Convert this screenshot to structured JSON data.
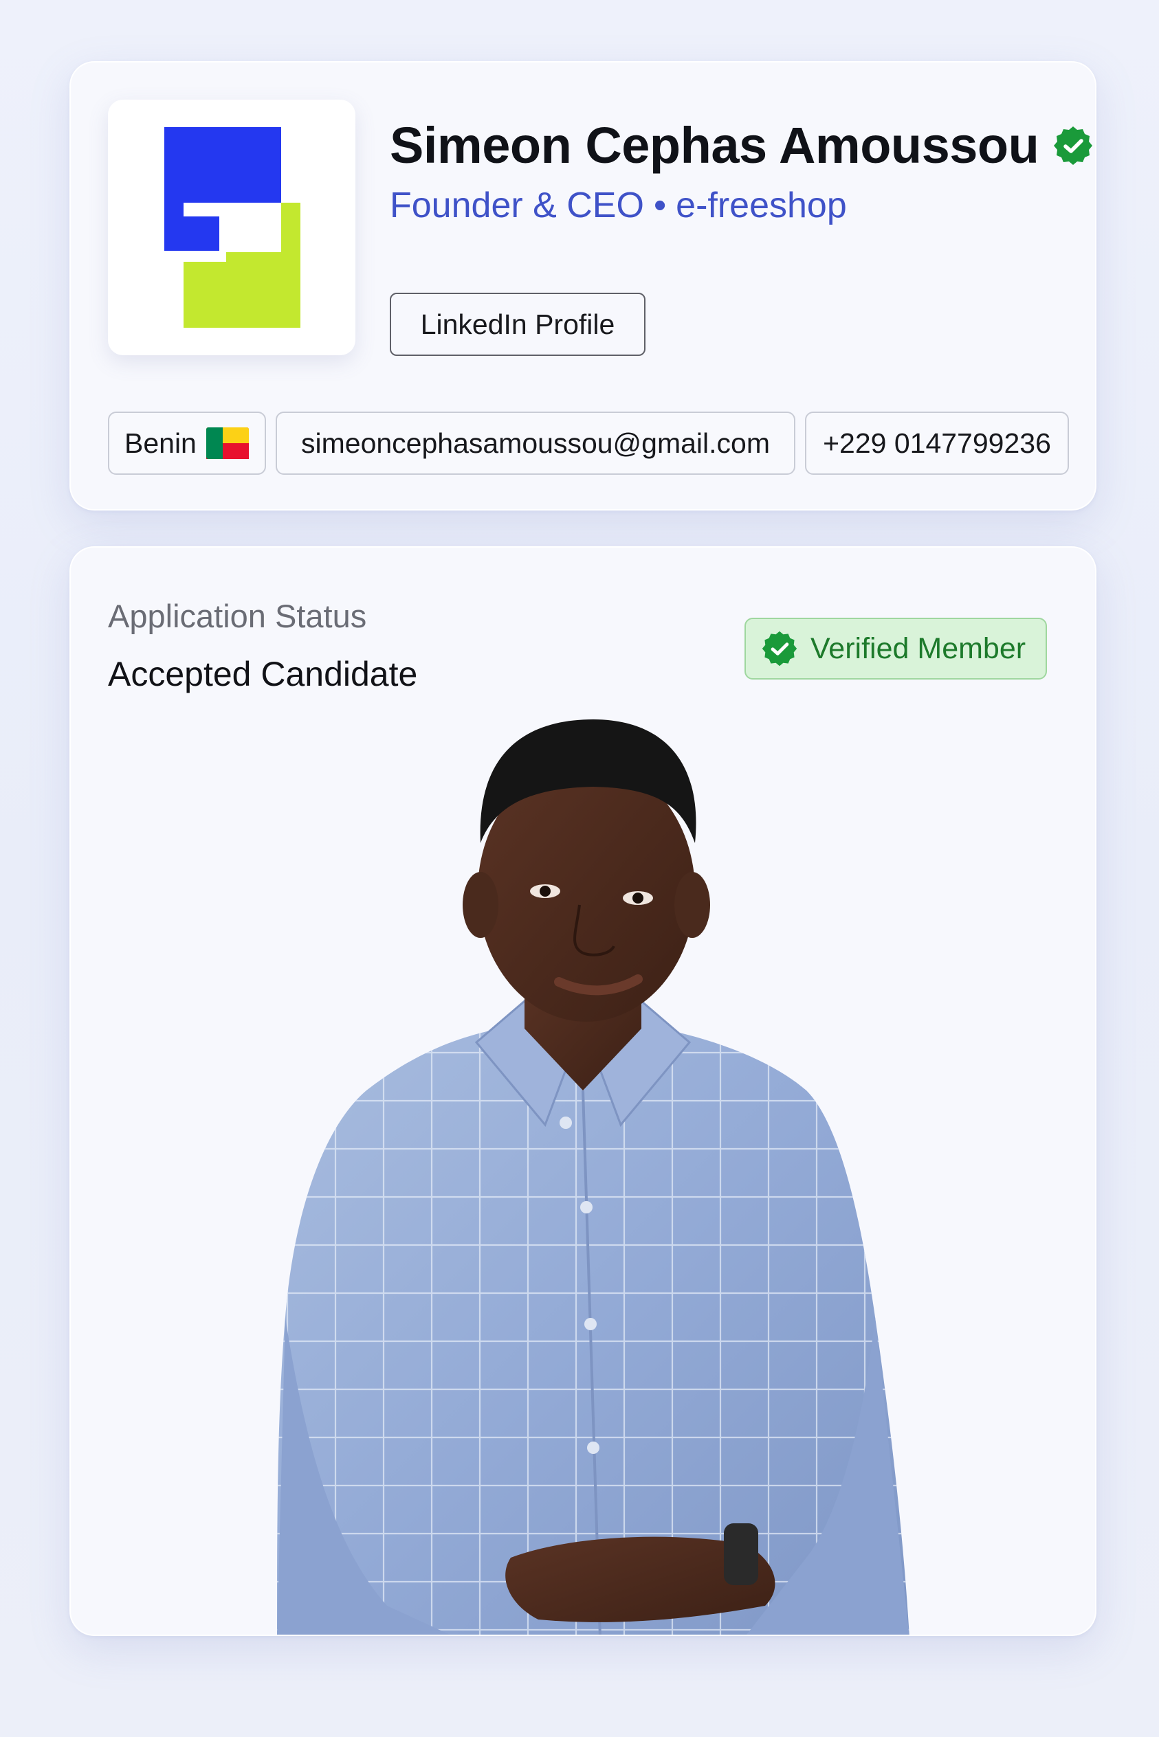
{
  "profile": {
    "name": "Simeon Cephas Amoussou",
    "role": "Founder & CEO",
    "separator": "•",
    "company": "e-freeshop",
    "linkedin_label": "LinkedIn Profile",
    "country": "Benin",
    "email": "simeoncephasamoussou@gmail.com",
    "phone": "+229 0147799236",
    "verified_icon": "verified-seal-icon",
    "flag_icon": "benin-flag-icon",
    "logo": "e-freeshop-logo"
  },
  "application": {
    "status_label": "Application Status",
    "status_value": "Accepted Candidate",
    "badge_label": "Verified Member",
    "badge_icon": "verified-seal-icon",
    "photo": "portrait-photo"
  },
  "colors": {
    "accent_blue": "#3f52c8",
    "logo_blue": "#2438f0",
    "logo_lime": "#c3e82f",
    "verified_green": "#1a9a3a",
    "badge_bg": "#d9f3d9",
    "badge_text": "#1d7a2b"
  }
}
